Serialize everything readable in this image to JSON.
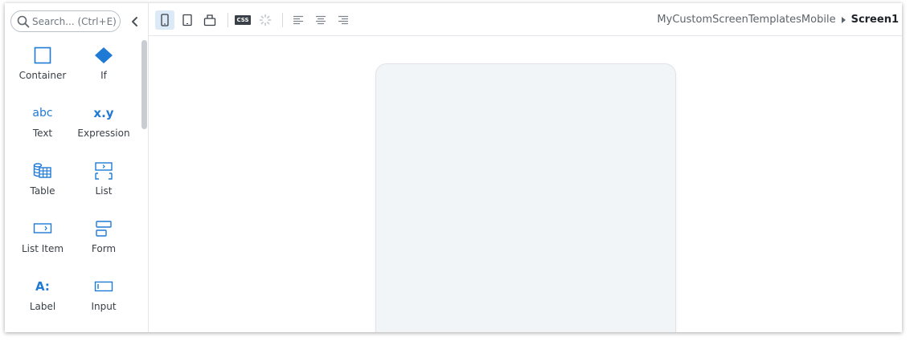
{
  "search": {
    "placeholder": "Search... (Ctrl+E)"
  },
  "widgets": [
    {
      "label": "Container",
      "icon": "container-icon"
    },
    {
      "label": "If",
      "icon": "if-diamond-icon"
    },
    {
      "label": "Text",
      "icon": "text-abc-icon",
      "glyph": "abc"
    },
    {
      "label": "Expression",
      "icon": "expression-icon",
      "glyph": "x.y"
    },
    {
      "label": "Table",
      "icon": "table-icon"
    },
    {
      "label": "List",
      "icon": "list-icon"
    },
    {
      "label": "List Item",
      "icon": "list-item-icon"
    },
    {
      "label": "Form",
      "icon": "form-icon"
    },
    {
      "label": "Label",
      "icon": "label-icon",
      "glyph": "A:"
    },
    {
      "label": "Input",
      "icon": "input-icon"
    }
  ],
  "toolbar": {
    "css_badge": "CSS",
    "breadcrumb": {
      "module": "MyCustomScreenTemplatesMobile",
      "screen": "Screen1"
    }
  },
  "colors": {
    "accent": "#1f7ad6",
    "active_bg": "#dce9f7",
    "device_bg": "#f2f5f7"
  }
}
